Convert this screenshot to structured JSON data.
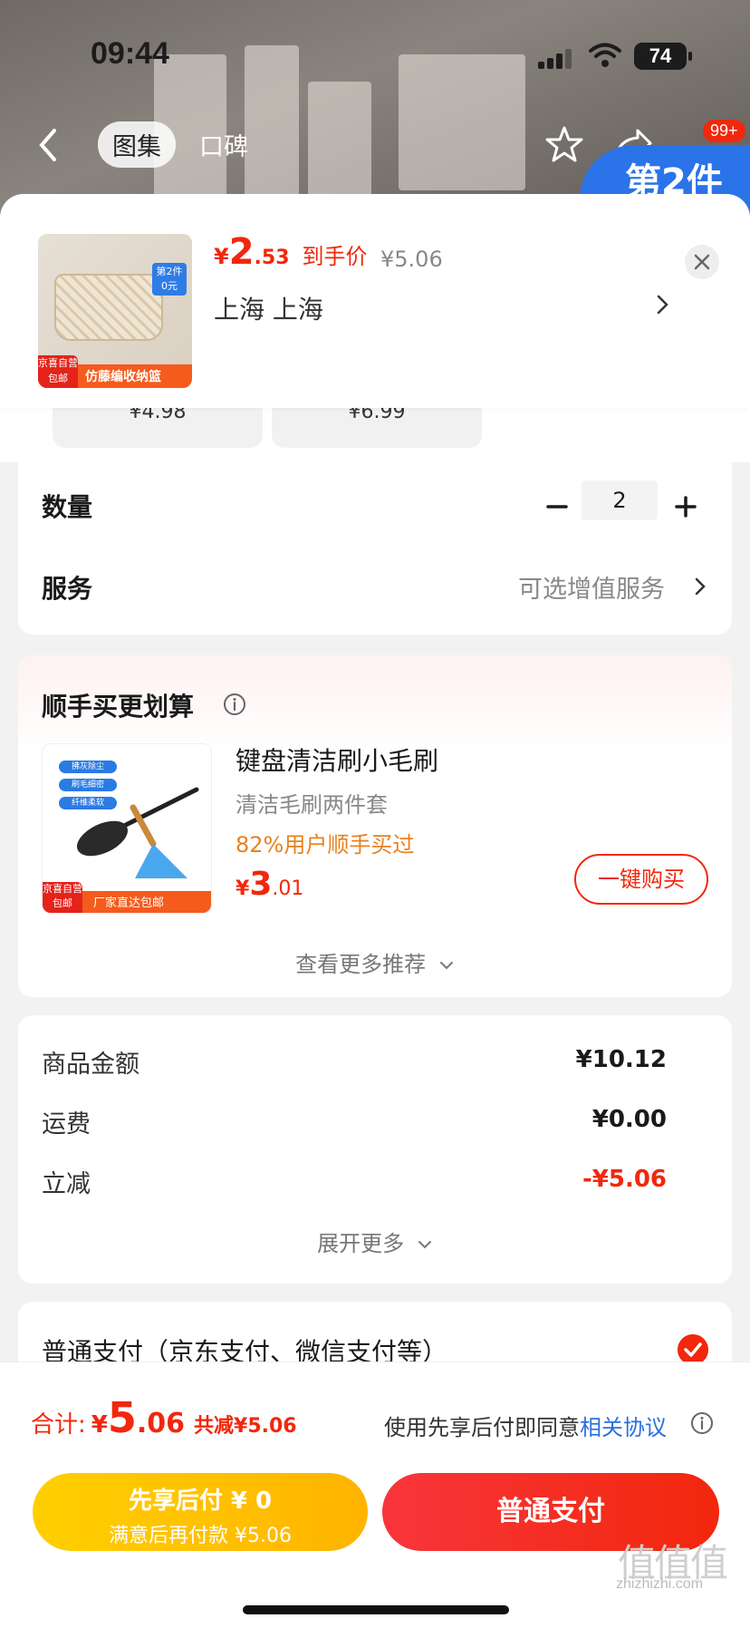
{
  "status_bar": {
    "time": "09:44",
    "battery": "74"
  },
  "product_nav": {
    "tabs": [
      {
        "label": "图集",
        "active": true
      },
      {
        "label": "口碑",
        "active": false
      }
    ],
    "badge": "99+",
    "promo_corner": "第2件"
  },
  "sheet_header": {
    "thumbnail": {
      "tag_line1": "第2件",
      "tag_line2": "0元",
      "self_operated_line1": "京喜自营",
      "self_operated_line2": "包邮",
      "bar_text": "仿藤编收纳篮"
    },
    "price": {
      "currency": "¥",
      "integer": "2",
      "decimal": ".53",
      "label": "到手价"
    },
    "original_price": "¥5.06",
    "address": "上海  上海"
  },
  "specs": [
    {
      "price": "¥4.98"
    },
    {
      "price": "¥6.99"
    }
  ],
  "quantity": {
    "label": "数量",
    "value": "2"
  },
  "service": {
    "label": "服务",
    "value": "可选增值服务"
  },
  "recommend": {
    "title": "顺手买更划算",
    "item": {
      "name": "键盘清洁刷小毛刷",
      "subtitle": "清洁毛刷两件套",
      "buy_rate": "82%用户顺手买过",
      "price": {
        "currency": "¥",
        "integer": "3",
        "decimal": ".01"
      },
      "image_pills": [
        "拂灰除尘",
        "刷毛细密",
        "纤维柔软"
      ],
      "self_operated_line1": "京喜自营",
      "self_operated_line2": "包邮",
      "bar_text": "厂家直达包邮"
    },
    "buy_button": "一键购买",
    "more": "查看更多推荐"
  },
  "fees": {
    "rows": [
      {
        "label": "商品金额",
        "value": "¥10.12"
      },
      {
        "label": "运费",
        "value": "¥0.00"
      },
      {
        "label": "立减",
        "value": "-¥5.06"
      }
    ],
    "expand": "展开更多"
  },
  "payment": {
    "label": "普通支付（京东支付、微信支付等）",
    "selected": true
  },
  "bottom": {
    "total_label": "合计:",
    "total": {
      "currency": "¥",
      "integer": "5",
      "decimal": ".06"
    },
    "saved": "共减¥5.06",
    "agree_prefix": "使用先享后付即同意",
    "agree_link": "相关协议",
    "pay_later": {
      "line1": "先享后付 ¥ 0",
      "line2": "满意后再付款 ¥5.06"
    },
    "pay_normal": "普通支付"
  },
  "watermark": "zhizhizhi.com",
  "colors": {
    "accent": "#f2270c",
    "pay_later": "#ffc200",
    "link": "#2a6fe0",
    "orange_text": "#e8811f"
  }
}
